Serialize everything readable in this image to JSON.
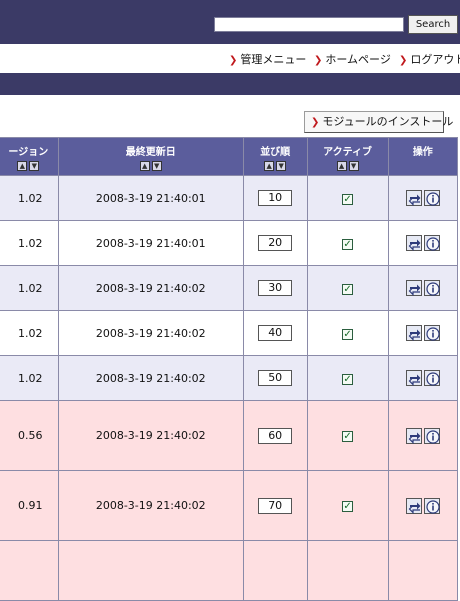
{
  "search": {
    "placeholder": "",
    "value": "",
    "button_label": "Search"
  },
  "top_links": [
    {
      "label": "管理メニュー"
    },
    {
      "label": "ホームページ"
    },
    {
      "label": "ログアウト"
    }
  ],
  "install_button_label": "モジュールのインストール",
  "table": {
    "headers": {
      "version": "ージョン",
      "updated": "最終更新日",
      "order": "並び順",
      "active": "アクティブ",
      "ops": "操作"
    },
    "rows": [
      {
        "version": "1.02",
        "updated": "2008-3-19 21:40:01",
        "order": "10",
        "active": true,
        "style": "blue"
      },
      {
        "version": "1.02",
        "updated": "2008-3-19 21:40:01",
        "order": "20",
        "active": true,
        "style": "white"
      },
      {
        "version": "1.02",
        "updated": "2008-3-19 21:40:02",
        "order": "30",
        "active": true,
        "style": "blue"
      },
      {
        "version": "1.02",
        "updated": "2008-3-19 21:40:02",
        "order": "40",
        "active": true,
        "style": "white"
      },
      {
        "version": "1.02",
        "updated": "2008-3-19 21:40:02",
        "order": "50",
        "active": true,
        "style": "blue"
      },
      {
        "version": "0.56",
        "updated": "2008-3-19 21:40:02",
        "order": "60",
        "active": true,
        "style": "pink"
      },
      {
        "version": "0.91",
        "updated": "2008-3-19 21:40:02",
        "order": "70",
        "active": true,
        "style": "pink"
      },
      {
        "version": "",
        "updated": "",
        "order": "",
        "active": false,
        "style": "pink"
      }
    ]
  },
  "colors": {
    "header_bar": "#3b3a66",
    "table_header": "#5b5d9c",
    "row_blue": "#eaeaf6",
    "row_pink": "#fedfe1",
    "arrow": "#c0181c"
  },
  "icons": {
    "sort_up": "▲",
    "sort_down": "▼",
    "update": "update-icon",
    "info": "info-icon",
    "checkmark": "✓",
    "link_arrow": "❯"
  }
}
